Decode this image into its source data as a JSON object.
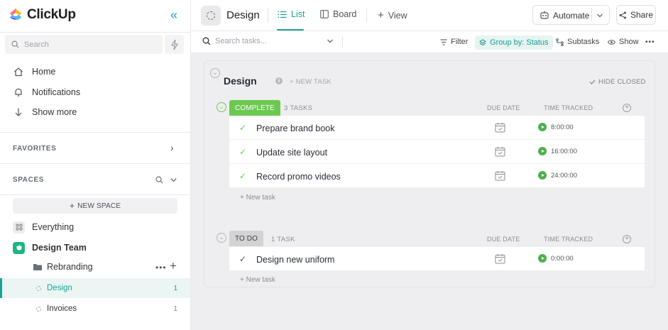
{
  "app": {
    "name": "ClickUp"
  },
  "sidebar": {
    "search_placeholder": "Search",
    "nav": [
      {
        "label": "Home",
        "icon": "home-icon"
      },
      {
        "label": "Notifications",
        "icon": "bell-icon"
      },
      {
        "label": "Show more",
        "icon": "arrow-down-icon"
      }
    ],
    "favorites_label": "FAVORITES",
    "spaces_label": "SPACES",
    "new_space_label": "NEW SPACE",
    "everything_label": "Everything",
    "space_name": "Design Team",
    "folder_name": "Rebranding",
    "lists": [
      {
        "label": "Design",
        "count": "1",
        "active": true
      },
      {
        "label": "Invoices",
        "count": "1",
        "active": false
      }
    ]
  },
  "header": {
    "title": "Design",
    "tabs": [
      {
        "label": "List",
        "active": true
      },
      {
        "label": "Board",
        "active": false
      }
    ],
    "add_view_label": "View",
    "automate_label": "Automate",
    "share_label": "Share"
  },
  "toolbar": {
    "search_placeholder": "Search tasks...",
    "filter_label": "Filter",
    "group_by_label": "Group by: Status",
    "subtasks_label": "Subtasks",
    "show_label": "Show"
  },
  "board": {
    "title": "Design",
    "new_task_label": "+ NEW TASK",
    "hide_closed_label": "HIDE CLOSED",
    "column_due": "DUE DATE",
    "column_time": "TIME TRACKED",
    "add_task_link": "+ New task",
    "groups": [
      {
        "status": "COMPLETE",
        "count_label": "3 TASKS",
        "color": "#6bc950",
        "tasks": [
          {
            "name": "Prepare brand book",
            "time": "8:00:00"
          },
          {
            "name": "Update site layout",
            "time": "16:00:00"
          },
          {
            "name": "Record promo videos",
            "time": "24:00:00"
          }
        ]
      },
      {
        "status": "TO DO",
        "count_label": "1 TASK",
        "color": "#d3d3d3",
        "tasks": [
          {
            "name": "Design new uniform",
            "time": "0:00:00"
          }
        ]
      }
    ]
  },
  "colors": {
    "accent": "#1aa395",
    "complete": "#6bc950",
    "todo": "#d3d3d3",
    "play": "#4cb04c"
  }
}
